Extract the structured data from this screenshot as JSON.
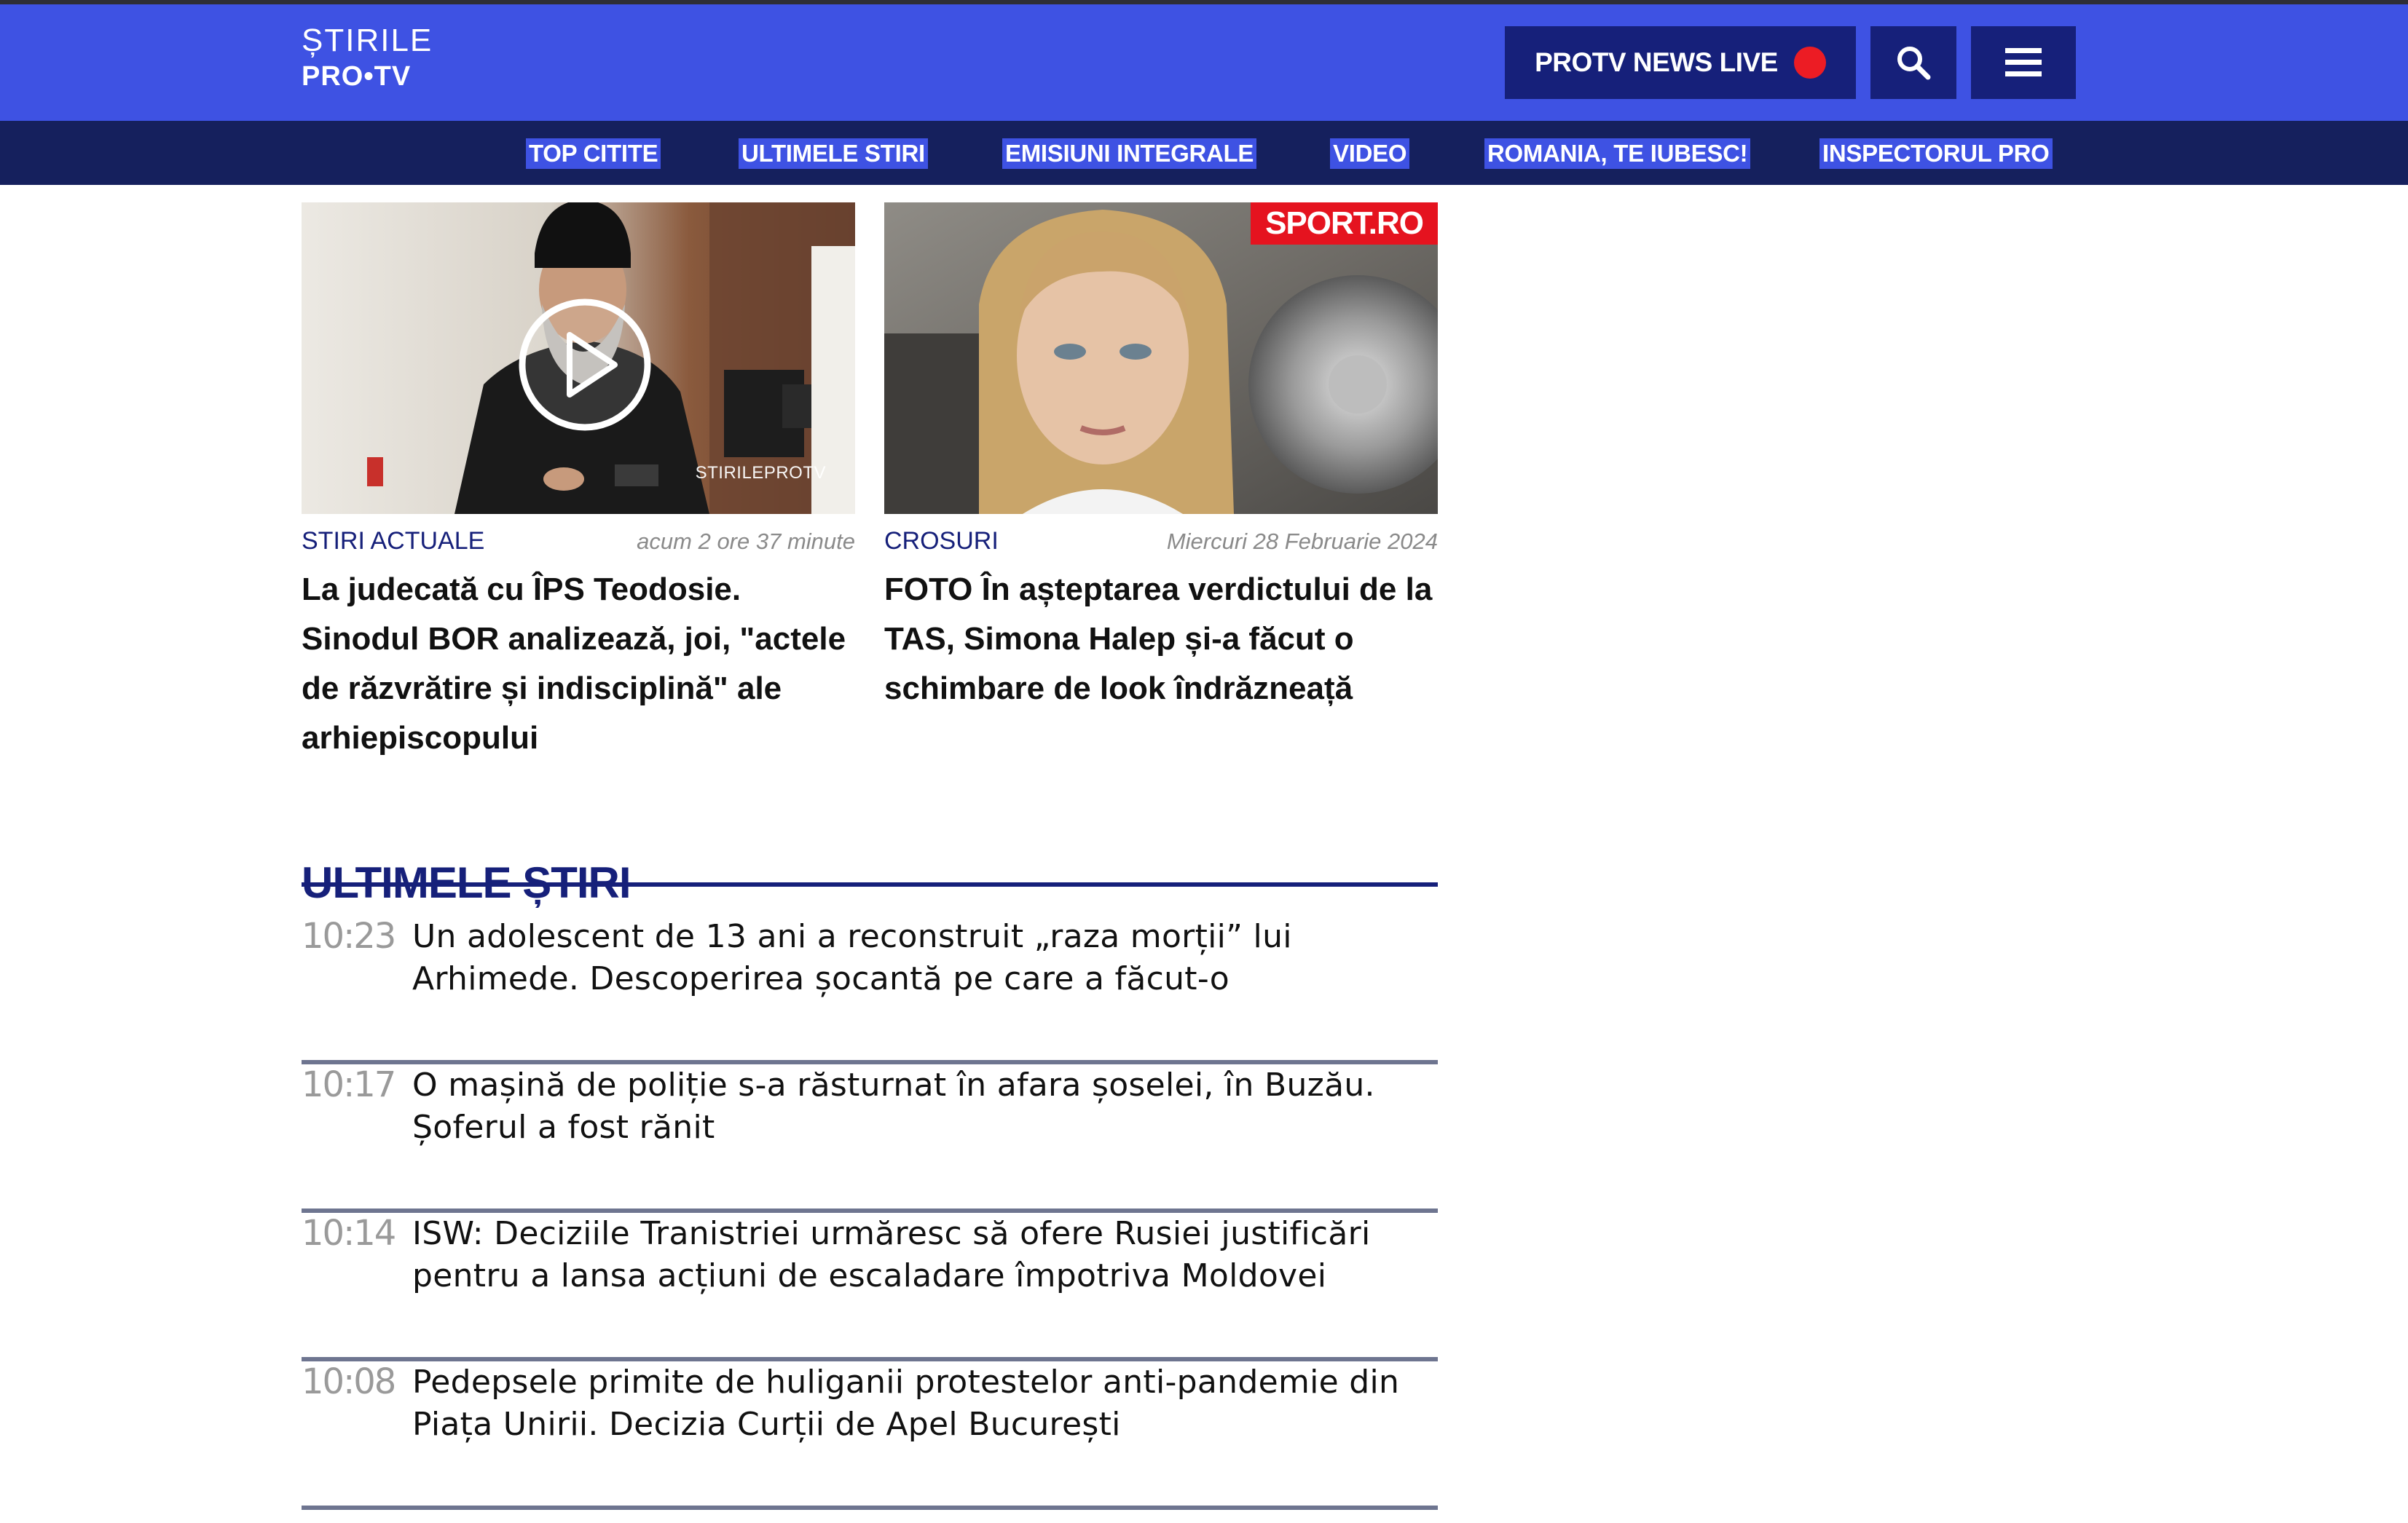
{
  "header": {
    "logo_line1": "ȘTIRILE",
    "logo_line2": "PRO•TV",
    "live_label": "PROTV NEWS LIVE",
    "search_icon": "search-icon",
    "menu_icon": "hamburger-menu-icon"
  },
  "nav": {
    "items": [
      {
        "label": "TOP CITITE"
      },
      {
        "label": "ULTIMELE STIRI"
      },
      {
        "label": "EMISIUNI INTEGRALE"
      },
      {
        "label": "VIDEO"
      },
      {
        "label": "ROMANIA, TE IUBESC!"
      },
      {
        "label": "INSPECTORUL PRO"
      }
    ]
  },
  "cards": [
    {
      "category": "STIRI ACTUALE",
      "time": "acum 2 ore 37 minute",
      "title": "La judecată cu ÎPS Teodosie. Sinodul BOR analizează, joi, \"actele de răzvrătire și indisciplină\" ale arhiepiscopului",
      "watermark": "STIRILEPROTV",
      "has_play_icon": true
    },
    {
      "category": "CROSURI",
      "time": "Miercuri 28 Februarie 2024",
      "title": "FOTO În așteptarea verdictului de la TAS, Simona Halep și-a făcut o schimbare de look îndrăzneață",
      "badge": "SPORT.RO"
    }
  ],
  "latest": {
    "title": "ULTIMELE ȘTIRI",
    "items": [
      {
        "time": "10:23",
        "title": "Un adolescent de 13 ani a reconstruit „raza morții” lui Arhimede. Descoperirea șocantă pe care a făcut-o"
      },
      {
        "time": "10:17",
        "title": "O mașină de poliție s-a răsturnat în afara șoselei, în Buzău. Șoferul a fost rănit"
      },
      {
        "time": "10:14",
        "title": "ISW: Deciziile Tranistriei urmăresc să ofere Rusiei justificări pentru a lansa acțiuni de escaladare împotriva Moldovei"
      },
      {
        "time": "10:08",
        "title": "Pedepsele primite de huliganii protestelor anti-pandemie din Piața Unirii. Decizia Curții de Apel București"
      }
    ]
  },
  "colors": {
    "header_bg": "#3e52e3",
    "nav_bg": "#15205d",
    "accent_dark": "#16207a",
    "live_dot": "#ec1c24",
    "sport_badge": "#e5131f"
  }
}
